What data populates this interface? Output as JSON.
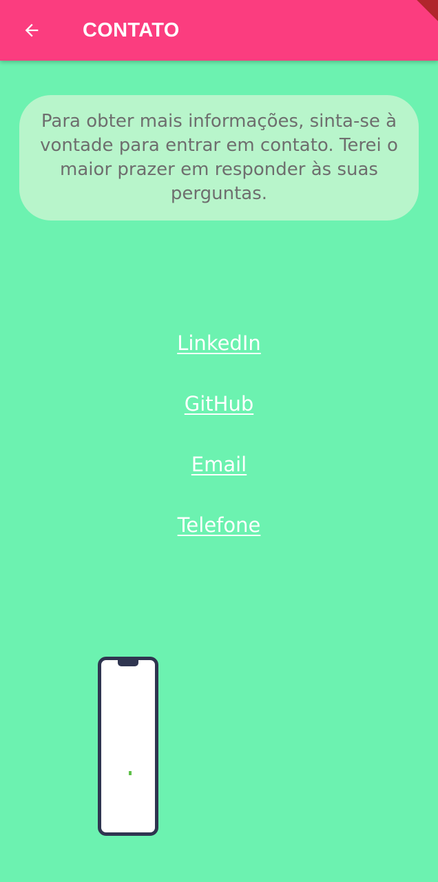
{
  "appbar": {
    "title": "CONTATO",
    "back_icon": "arrow-back-icon",
    "color": "#fb3d7f"
  },
  "info_card": {
    "text": "Para obter mais informações, sinta-se à vontade para entrar em contato. Terei o maior prazer em responder às suas perguntas."
  },
  "links": [
    {
      "label": "LinkedIn"
    },
    {
      "label": "GitHub"
    },
    {
      "label": "Email"
    },
    {
      "label": "Telefone"
    }
  ],
  "illustration": {
    "icon": "smartphone-icon"
  },
  "colors": {
    "background": "#6cf2b0",
    "card": "#b8f5cb",
    "accent": "#fb3d7f"
  }
}
